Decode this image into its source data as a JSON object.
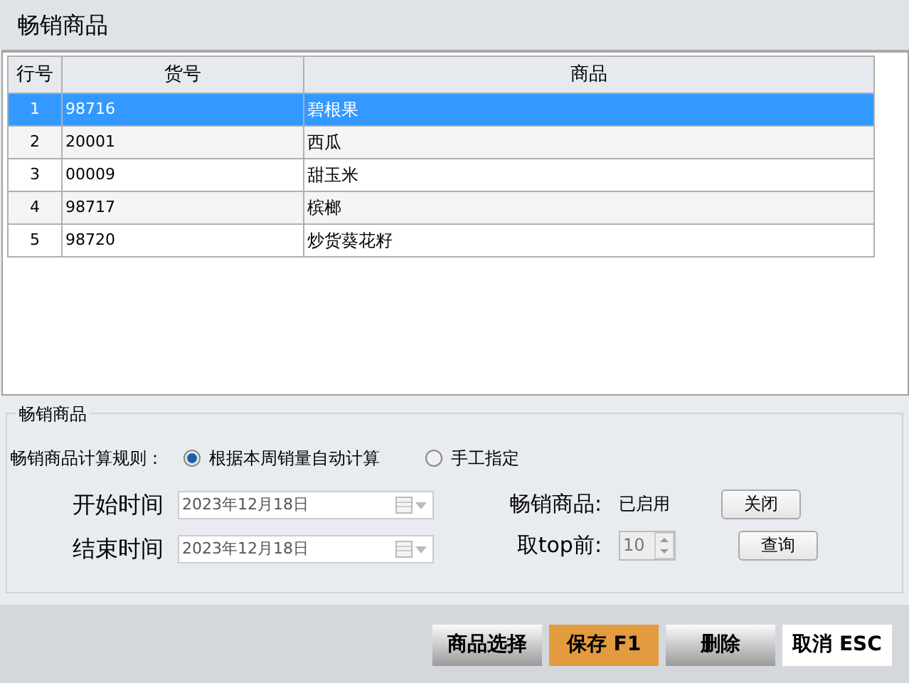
{
  "window": {
    "title": "畅销商品"
  },
  "table": {
    "columns": [
      "行号",
      "货号",
      "商品"
    ],
    "rows": [
      {
        "cells": [
          "1",
          "98716",
          "碧根果"
        ],
        "selected": true
      },
      {
        "cells": [
          "2",
          "20001",
          "西瓜"
        ],
        "selected": false
      },
      {
        "cells": [
          "3",
          "00009",
          "甜玉米"
        ],
        "selected": false
      },
      {
        "cells": [
          "4",
          "98717",
          "槟榔"
        ],
        "selected": false
      },
      {
        "cells": [
          "5",
          "98720",
          "炒货葵花籽"
        ],
        "selected": false
      }
    ]
  },
  "settings": {
    "title": "畅销商品",
    "rule_label": "畅销商品计算规则：",
    "options": [
      {
        "label": "根据本周销量自动计算",
        "selected": true
      },
      {
        "label": "手工指定",
        "selected": false
      }
    ],
    "start": {
      "label": "开始时间",
      "value": "2023年12月18日",
      "disabled": true
    },
    "end": {
      "label": "结束时间",
      "value": "2023年12月18日",
      "disabled": true
    },
    "status": {
      "label": "畅销商品:",
      "value": "已启用"
    },
    "top": {
      "label": "取top前:",
      "value": "10",
      "disabled": true
    },
    "close_button": "关闭",
    "query_button": "查询"
  },
  "footer_buttons": [
    {
      "label": "商品选择",
      "kind": "gradient"
    },
    {
      "label": "保存 F1",
      "kind": "accent"
    },
    {
      "label": "删除",
      "kind": "gradient"
    },
    {
      "label": "取消 ESC",
      "kind": "plain"
    }
  ]
}
